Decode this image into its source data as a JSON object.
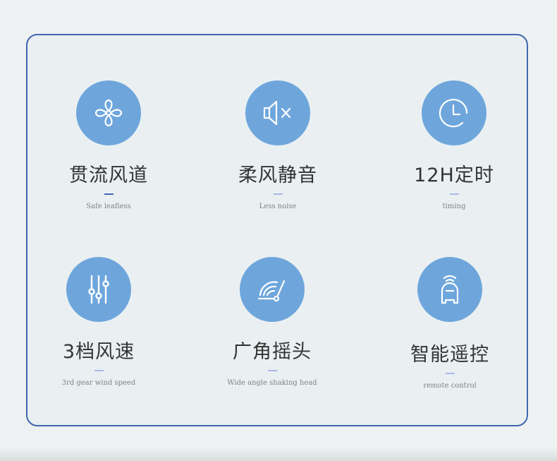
{
  "features": [
    {
      "icon": "fan-icon",
      "title": "贯流风道",
      "subtitle": "Safe leafless",
      "dash_color": "#3e67b0"
    },
    {
      "icon": "mute-speaker-icon",
      "title": "柔风静音",
      "subtitle": "Less noise",
      "dash_color": "#a7b7e8"
    },
    {
      "icon": "clock-icon",
      "title": "12H定时",
      "subtitle": "timing",
      "dash_color": "#a7b7e8"
    },
    {
      "icon": "sliders-icon",
      "title": "3档风速",
      "subtitle": "3rd gear wind speed",
      "dash_color": "#a7b7e8"
    },
    {
      "icon": "oscillation-icon",
      "title": "广角摇头",
      "subtitle": "Wide angle shaking head",
      "dash_color": "#a7b7e8"
    },
    {
      "icon": "remote-control-icon",
      "title": "智能遥控",
      "subtitle": "remote control",
      "dash_color": "#a7b7e8"
    }
  ]
}
